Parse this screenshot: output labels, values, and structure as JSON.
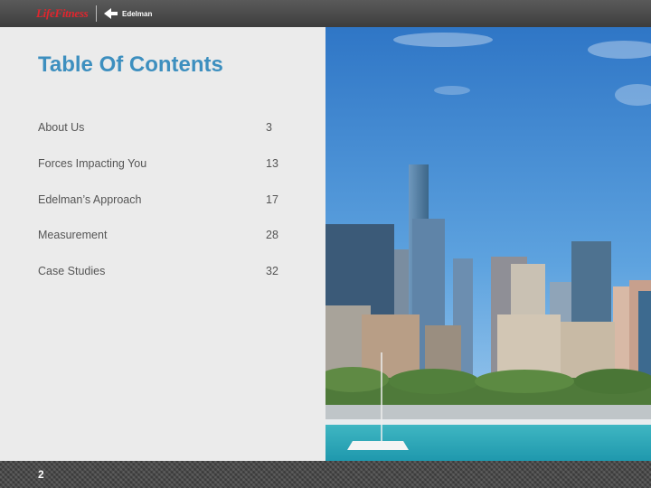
{
  "header": {
    "brand_left": "LifeFitness",
    "brand_right": "Edelman"
  },
  "slide": {
    "title": "Table Of Contents",
    "page_number": "2"
  },
  "toc": [
    {
      "label": "About Us",
      "page": "3"
    },
    {
      "label": "Forces Impacting You",
      "page": "13"
    },
    {
      "label": "Edelman’s Approach",
      "page": "17"
    },
    {
      "label": "Measurement",
      "page": "28"
    },
    {
      "label": "Case Studies",
      "page": "32"
    }
  ],
  "colors": {
    "title": "#3d8fbf",
    "brand_red": "#e0262e",
    "bar": "#4a4a4a"
  }
}
